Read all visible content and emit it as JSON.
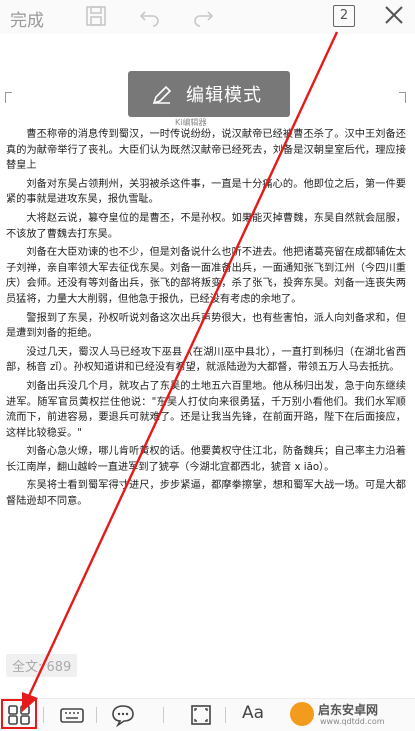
{
  "topbar": {
    "done_label": "完成",
    "page_count": "2"
  },
  "toast": {
    "label": "编辑模式",
    "sub": "Ki编辑器"
  },
  "document": {
    "paragraphs": [
      "曹丕称帝的消息传到蜀汉，一时传说纷纷，说汉献帝已经被曹丕杀了。汉中王刘备还真的为献帝举行了丧礼。大臣们认为既然汉献帝已经死去，刘备是汉朝皇室后代，理应接替皇上",
      "刘备对东吴占领荆州，关羽被杀这件事，一直是十分痛心的。他即位之后，第一件要紧的事就是进攻东吴，报仇雪耻。",
      "大将赵云说，篡夺皇位的是曹丕，不是孙权。如果能灭掉曹魏，东吴自然就会屈服，不该放了曹魏去打东吴。",
      "刘备在大臣劝谏的也不少，但是刘备说什么也听不进去。他把诸葛亮留在成都辅佐太子刘禅，亲自率领大军去征伐东吴。刘备一面准备出兵，一面通知张飞到江州（今四川重庆）会师。还没有等刘备出兵，张飞的部将叛变，杀了张飞，投奔东吴。刘备一连丧失两员猛将，力量大大削弱，但他急于报仇，已经没有考虑的余地了。",
      "警报到了东吴，孙权听说刘备这次出兵声势很大，也有些害怕，派人向刘备求和，但是遭到刘备的拒绝。",
      "没过几天，蜀汉人马已经攻下巫县（在湖川巫中县北），一直打到秭归（在湖北省西部，秭音 zǐ）。孙权知道讲和已经没有希望，就派陆逊为大都督，带领五万人马去抵抗。",
      "刘备出兵没几个月，就攻占了东吴的土地五六百里地。他从秭归出发，急于向东继续进军。随军官员黄权拦住他说：\"东吴人打仗向来很勇猛，千万别小看他们。我们水军顺流而下，前进容易，要退兵可就难了。还是让我当先锋，在前面开路，陛下在后面接应，这样比较稳妥。\"",
      "刘备心急火燎，哪儿肯听黄权的话。他要黄权守住江北，防备魏兵；自己率主力沿着长江南岸，翻山越岭一直进军到了猇亭（今湖北宜都西北，猇音 x iāo）。",
      "东吴将士看到蜀军得寸进尺，步步紧逼，都摩拳擦掌，想和蜀军大战一场。可是大都督陆逊却不同意。"
    ]
  },
  "word_count": "全文: 689",
  "watermark": {
    "name": "启东安卓网",
    "url": "www.qdtdd.com"
  },
  "colors": {
    "highlight": "#e51b1b",
    "arrow": "#e51b1b"
  },
  "icons": [
    "save-icon",
    "undo-icon",
    "redo-icon",
    "close-icon",
    "pen-icon",
    "grid-icon",
    "keyboard-icon",
    "comment-icon",
    "fullscreen-icon"
  ]
}
